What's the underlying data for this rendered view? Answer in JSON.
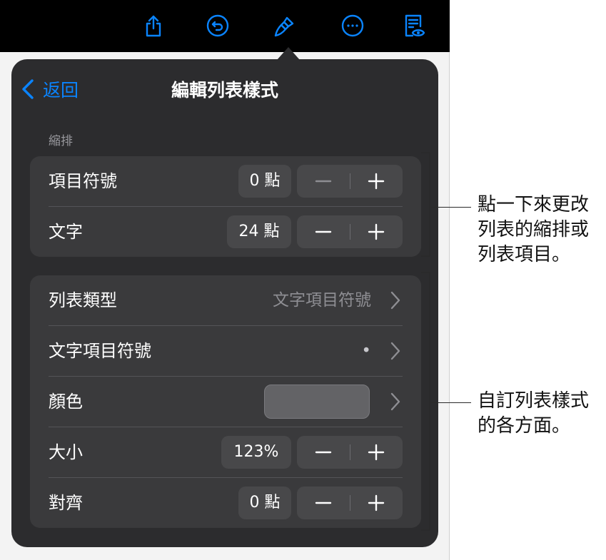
{
  "toolbar": {
    "icons": [
      "share-icon",
      "undo-icon",
      "format-paintbrush-icon",
      "more-icon",
      "reader-view-icon"
    ],
    "accent": "#0a84ff"
  },
  "panel": {
    "back_label": "返回",
    "title": "編輯列表樣式"
  },
  "indent": {
    "header": "縮排",
    "rows": [
      {
        "label": "項目符號",
        "value": "0 點"
      },
      {
        "label": "文字",
        "value": "24 點"
      }
    ]
  },
  "style": {
    "list_type": {
      "label": "列表類型",
      "value": "文字項目符號"
    },
    "text_bullet": {
      "label": "文字項目符號",
      "value": "•"
    },
    "color": {
      "label": "顏色",
      "swatch": "#636366"
    },
    "size": {
      "label": "大小",
      "value": "123%"
    },
    "align": {
      "label": "對齊",
      "value": "0 點"
    }
  },
  "callouts": [
    {
      "lines": [
        "點一下來更改",
        "列表的縮排或",
        "列表項目。"
      ]
    },
    {
      "lines": [
        "自訂列表樣式",
        "的各方面。"
      ]
    }
  ]
}
